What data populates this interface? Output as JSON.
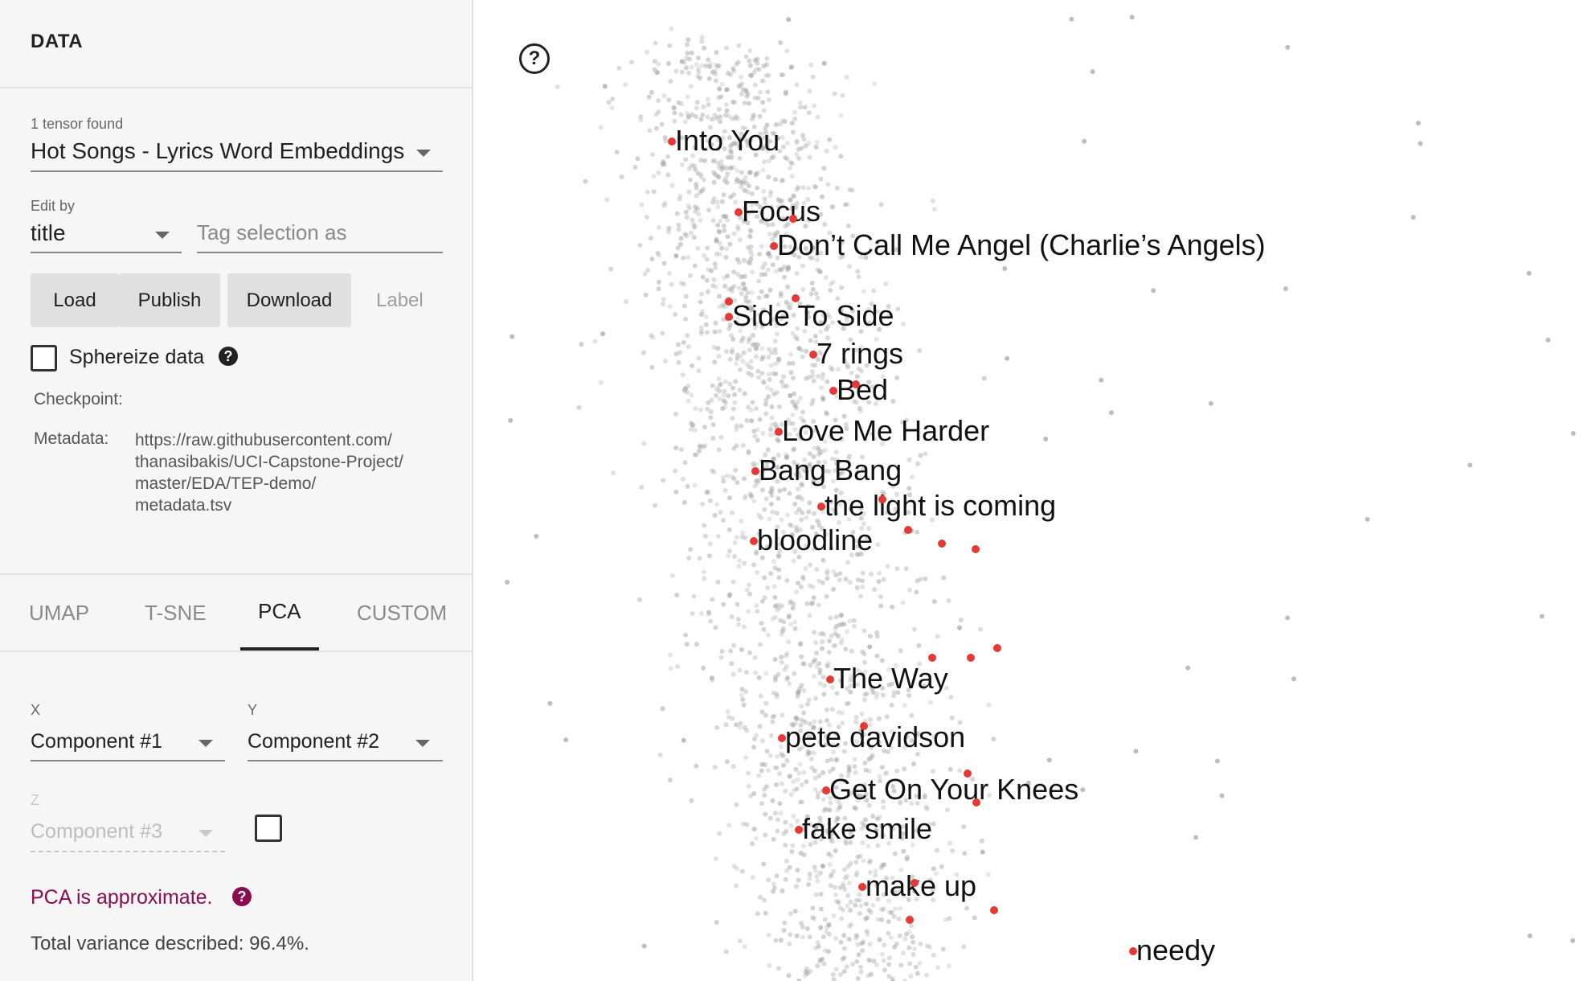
{
  "sidebar": {
    "header": "DATA",
    "tensor_count": "1 tensor found",
    "tensor_select": "Hot Songs - Lyrics Word Embeddings",
    "edit_by_label": "Edit by",
    "edit_by_value": "title",
    "tag_placeholder": "Tag selection as",
    "buttons": {
      "load": "Load",
      "publish": "Publish",
      "download": "Download",
      "label": "Label"
    },
    "sphereize_label": "Sphereize data",
    "checkpoint_label": "Checkpoint:",
    "metadata_label": "Metadata:",
    "metadata_lines": [
      "https://raw.githubusercontent.com/",
      "thanasibakis/UCI-Capstone-Project/",
      "master/EDA/TEP-demo/",
      "metadata.tsv"
    ],
    "tabs": [
      "UMAP",
      "T-SNE",
      "PCA",
      "CUSTOM"
    ],
    "active_tab": "PCA",
    "x_label": "X",
    "x_value": "Component #1",
    "y_label": "Y",
    "y_value": "Component #2",
    "z_label": "Z",
    "z_value": "Component #3",
    "pca_note": "PCA is approximate.",
    "variance_text": "Total variance described: 96.4%.",
    "colors": {
      "pca_note": "#880e4f",
      "active_tab_underline": "#222222",
      "point_gray": "#9e9e9e",
      "point_red": "#e53935"
    }
  },
  "plot": {
    "help_icon": "help-circle-icon",
    "labels": [
      "Into You",
      "Focus",
      "Don’t Call Me Angel (Charlie’s Angels)",
      "Side To Side",
      "7 rings",
      "Bed",
      "Love Me Harder",
      "Bang Bang",
      "the light is coming",
      "bloodline",
      "The Way",
      "pete davidson",
      "Get On Your Knees",
      "fake smile",
      "make up",
      "needy"
    ]
  }
}
